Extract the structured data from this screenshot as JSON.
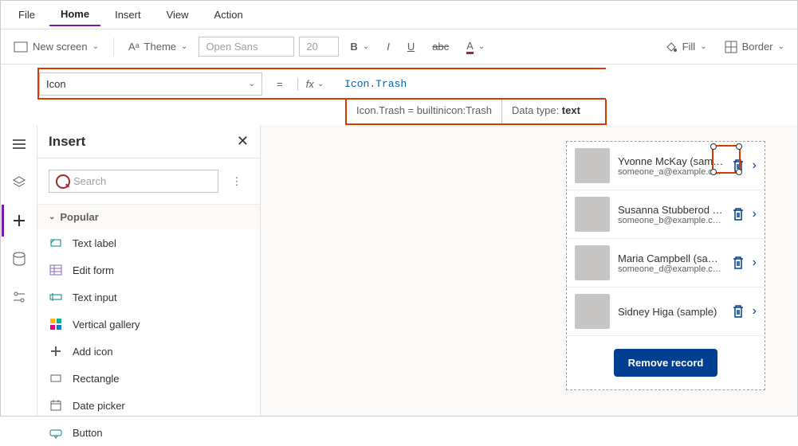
{
  "menu": {
    "file": "File",
    "home": "Home",
    "insert": "Insert",
    "view": "View",
    "action": "Action"
  },
  "toolbar": {
    "new_screen": "New screen",
    "theme": "Theme",
    "font": "Open Sans",
    "size": "20",
    "fill": "Fill",
    "border": "Border"
  },
  "formula": {
    "property": "Icon",
    "value": "Icon.Trash",
    "intellisense": "Icon.Trash  =  builtinicon:Trash",
    "datatype_label": "Data type: ",
    "datatype_value": "text"
  },
  "insert_panel": {
    "title": "Insert",
    "search_placeholder": "Search",
    "category": "Popular",
    "items": [
      {
        "label": "Text label",
        "icon": "text-label-icon"
      },
      {
        "label": "Edit form",
        "icon": "edit-form-icon"
      },
      {
        "label": "Text input",
        "icon": "text-input-icon"
      },
      {
        "label": "Vertical gallery",
        "icon": "vertical-gallery-icon"
      },
      {
        "label": "Add icon",
        "icon": "add-icon-icon"
      },
      {
        "label": "Rectangle",
        "icon": "rectangle-icon"
      },
      {
        "label": "Date picker",
        "icon": "date-picker-icon"
      },
      {
        "label": "Button",
        "icon": "button-icon"
      }
    ]
  },
  "gallery": {
    "rows": [
      {
        "name": "Yvonne McKay (sample)",
        "email": "someone_a@example.com"
      },
      {
        "name": "Susanna Stubberod (sample)",
        "email": "someone_b@example.com"
      },
      {
        "name": "Maria Campbell (sample)",
        "email": "someone_d@example.com"
      },
      {
        "name": "Sidney Higa (sample)",
        "email": ""
      }
    ],
    "remove_button": "Remove record"
  }
}
